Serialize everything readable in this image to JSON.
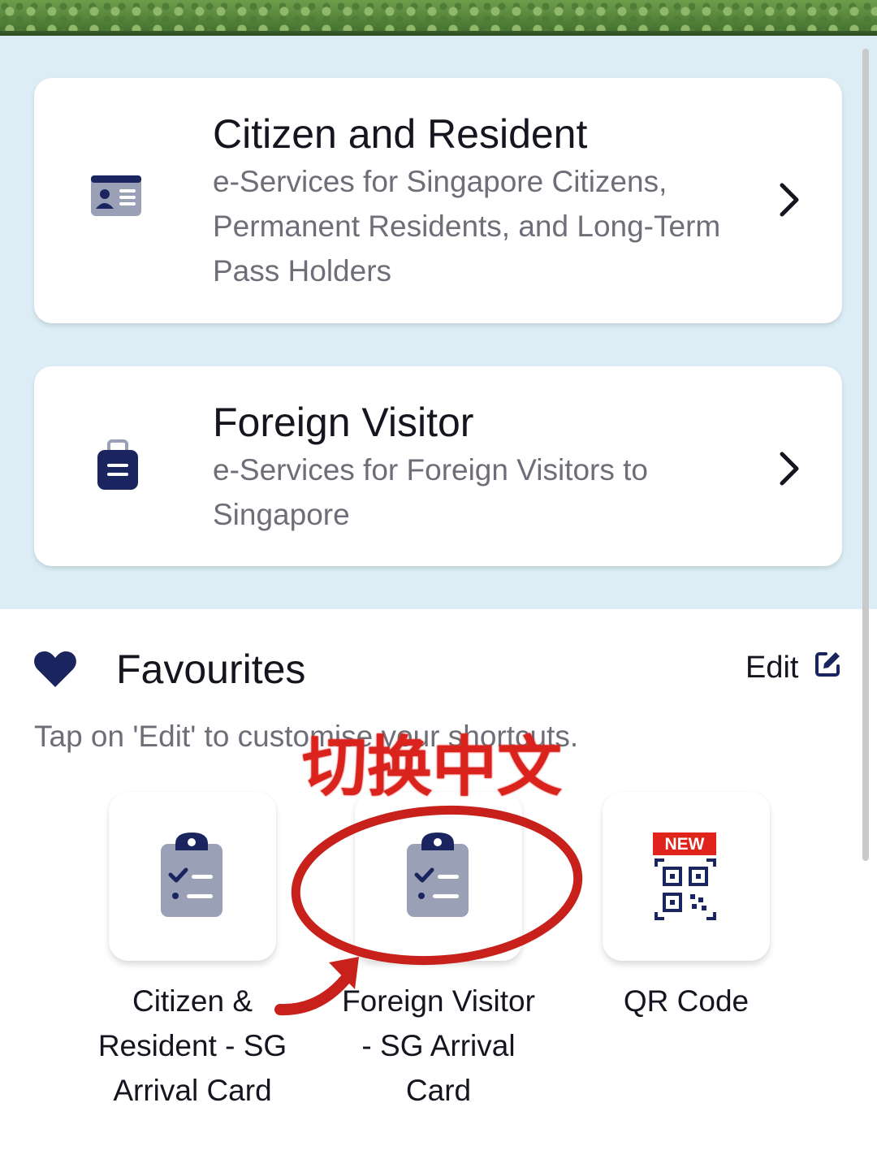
{
  "cards": {
    "citizen": {
      "title": "Citizen and Resident",
      "description": "e-Services for Singapore Citizens, Permanent Residents, and Long-Term Pass Holders",
      "icon": "id-card-icon"
    },
    "foreign": {
      "title": "Foreign Visitor",
      "description": "e-Services for Foreign Visitors to Singapore",
      "icon": "luggage-icon"
    }
  },
  "favourites": {
    "title": "Favourites",
    "edit_label": "Edit",
    "hint": "Tap on 'Edit' to customise your shortcuts.",
    "items": [
      {
        "label": "Citizen & Resident - SG Arrival Card",
        "icon": "clipboard-checklist-icon"
      },
      {
        "label": "Foreign Visitor - SG Arrival Card",
        "icon": "clipboard-checklist-icon"
      },
      {
        "label": "QR Code",
        "icon": "qr-code-icon",
        "badge": "NEW"
      }
    ]
  },
  "annotation": {
    "text": "切换中文"
  },
  "colors": {
    "navy": "#1a2560",
    "panel_bg": "#dcedf5",
    "annotation_red": "#d9231c",
    "badge_red": "#e0241b"
  }
}
